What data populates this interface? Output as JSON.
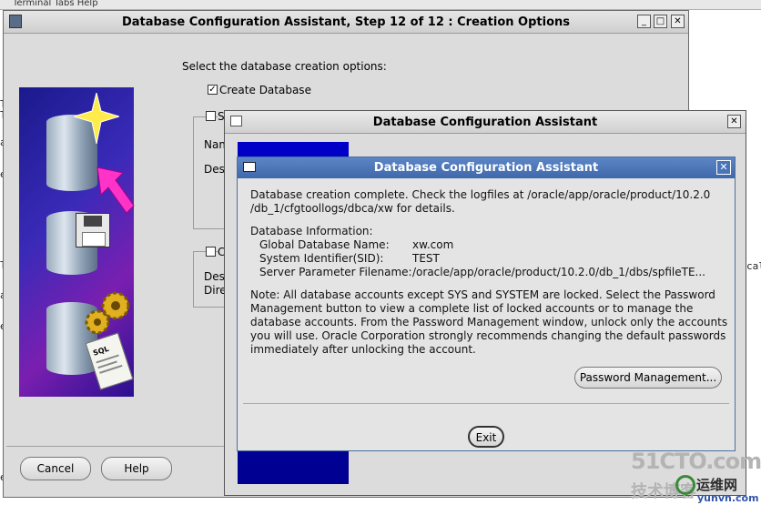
{
  "background": {
    "menu": "Terminal  Tabs  Help",
    "edge_chars": [
      "T",
      "T",
      "a",
      "e",
      "T",
      "a",
      "e",
      "e"
    ],
    "right_fragment": "cal"
  },
  "main_window": {
    "title": "Database Configuration Assistant, Step 12 of 12 : Creation Options",
    "controls": [
      "_",
      "□",
      "✕"
    ],
    "prompt": "Select the database creation options:",
    "create_database": {
      "label": "Create Database",
      "checked": true
    },
    "save_template": {
      "label": "S",
      "checked": false
    },
    "name_label": "Nam",
    "description_label": "Des",
    "script_option": {
      "label": "C",
      "checked": false
    },
    "script_description_label": "Des",
    "directory_label": "Dire",
    "cancel_button": "Cancel",
    "help_button": "Help"
  },
  "progress_dialog": {
    "title": "Database Configuration Assistant",
    "close": "✕"
  },
  "completion_dialog": {
    "title": "Database Configuration Assistant",
    "close": "✕",
    "line1": "Database creation complete. Check the logfiles at /oracle/app/oracle/product/10.2.0",
    "line2": "/db_1/cfgtoollogs/dbca/xw for details.",
    "info_heading": "Database Information:",
    "info_rows": [
      {
        "label": "Global Database Name:",
        "value": "xw.com"
      },
      {
        "label": "System Identifier(SID):",
        "value": "TEST"
      },
      {
        "label": "Server Parameter Filename:",
        "value": "/oracle/app/oracle/product/10.2.0/db_1/dbs/spfileTE..."
      }
    ],
    "note_lines": [
      "Note: All database accounts except SYS and SYSTEM are locked. Select the Password",
      "Management button to view a complete list of locked accounts or to manage the",
      "database accounts. From the Password Management window, unlock only the accounts",
      "you will use. Oracle Corporation strongly recommends changing the default passwords",
      "immediately after unlocking the account."
    ],
    "password_button": "Password Management...",
    "exit_button": "Exit"
  },
  "watermark": {
    "logo": "51CTO.com",
    "tagline": "技术博客",
    "site_cn": "运维网",
    "site_url": "yunvn.com"
  },
  "colors": {
    "titlebar_active": "#3f68aa",
    "dialog_bg": "#e4e4e4",
    "window_bg": "#dcdcdc",
    "banner_blue": "#0000c8"
  }
}
